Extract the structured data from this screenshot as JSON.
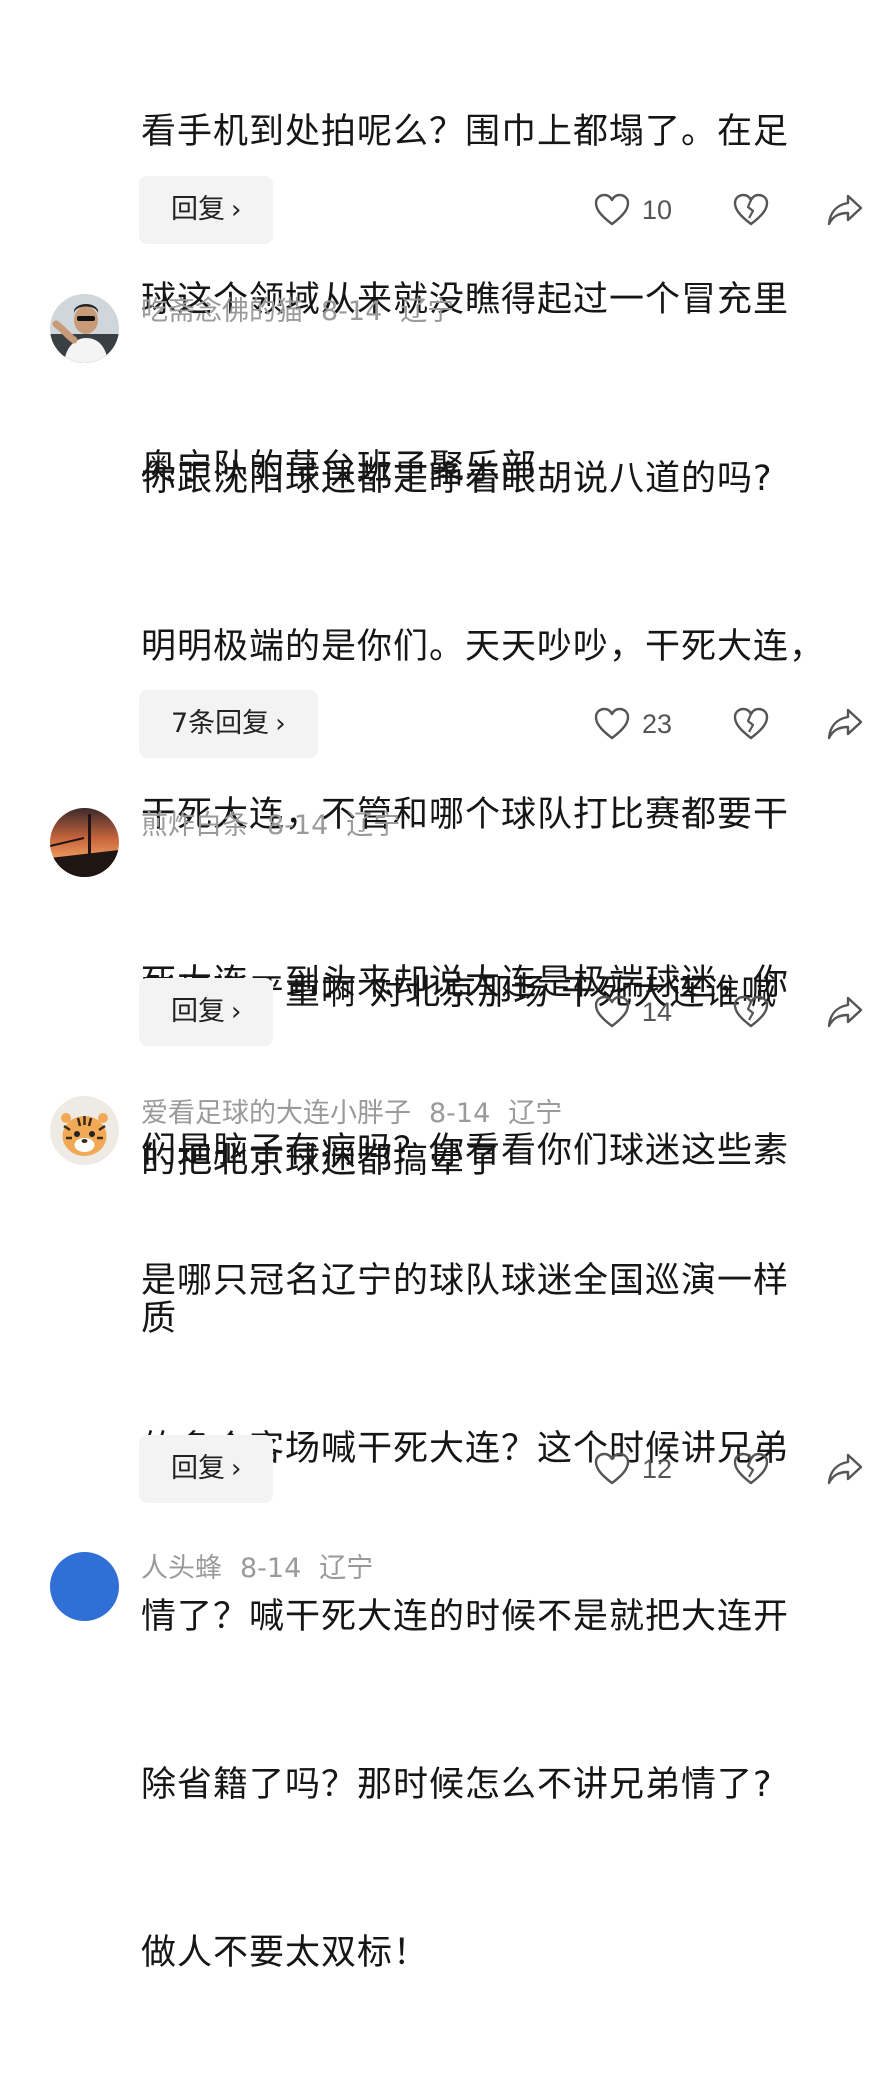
{
  "comments": [
    {
      "partial": true,
      "text": "看手机到处拍呢么？围巾上都塌了。在足球这个领域从来就没瞧得起过一个冒充里奥宁队的草台班子聚乐部",
      "lines": [
        "看手机到处拍呢么？围巾上都塌了。在足",
        "球这个领域从来就没瞧得起过一个冒充里",
        "奥宁队的草台班子聚乐部"
      ],
      "reply_label": "回复",
      "likes": "10"
    },
    {
      "username": "吃斋念佛的猫",
      "date": "8-14",
      "location": "辽宁",
      "lines": [
        "你跟沈阳球迷都是睁着眼胡说八道的吗?",
        "明明极端的是你们。天天吵吵，干死大连，",
        "干死大连，不管和哪个球队打比赛都要干",
        "死大连。到头来却说大连是极端球迷，你",
        "们是脑子有病吗？你看看你们球迷这些素",
        "质"
      ],
      "reply_label": "7条回复",
      "likes": "23"
    },
    {
      "username": "煎炸白条",
      "date": "8-14",
      "location": "辽宁",
      "lines": [
        "双标挺严重啊 对北京那场 干死大连谁喊",
        "的把北京球迷都搞晕了"
      ],
      "reply_label": "回复",
      "likes": "14"
    },
    {
      "username": "爱看足球的大连小胖子",
      "date": "8-14",
      "location": "辽宁",
      "lines": [
        "是哪只冠名辽宁的球队球迷全国巡演一样",
        "的多个客场喊干死大连？这个时候讲兄弟",
        "情了？喊干死大连的时候不是就把大连开",
        "除省籍了吗？那时候怎么不讲兄弟情了?",
        "做人不要太双标！"
      ],
      "reply_label": "回复",
      "likes": "12"
    },
    {
      "partial": true,
      "username": "人头蜂",
      "date": "8-14",
      "location": "辽宁"
    }
  ],
  "icons": {
    "like": "heart-outline-icon",
    "dislike": "broken-heart-icon",
    "share": "share-arrow-icon",
    "reply_chevron": "›"
  },
  "colors": {
    "meta_text": "#9a9a9a",
    "reply_button_bg": "#f3f3f3",
    "icon_stroke": "#555555",
    "avatar_partial": "#2f6fd6"
  }
}
